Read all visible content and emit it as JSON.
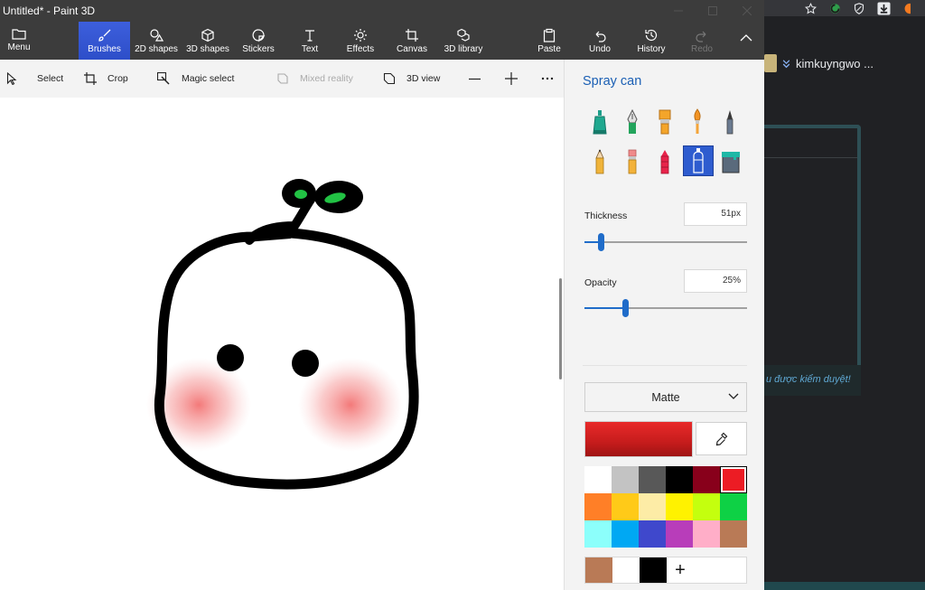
{
  "window": {
    "title": "Untitled* - Paint 3D"
  },
  "ribbon": {
    "menu": "Menu",
    "brushes": "Brushes",
    "shapes2d": "2D shapes",
    "shapes3d": "3D shapes",
    "stickers": "Stickers",
    "text": "Text",
    "effects": "Effects",
    "canvas": "Canvas",
    "library": "3D library",
    "paste": "Paste",
    "undo": "Undo",
    "history": "History",
    "redo": "Redo"
  },
  "toolbar": {
    "select": "Select",
    "crop": "Crop",
    "magic_select": "Magic select",
    "mixed_reality": "Mixed reality",
    "view3d": "3D view"
  },
  "panel": {
    "title": "Spray can",
    "thickness_label": "Thickness",
    "thickness_value": "51px",
    "thickness_fraction": 0.1,
    "opacity_label": "Opacity",
    "opacity_value": "25%",
    "opacity_fraction": 0.25,
    "finish": "Matte",
    "current_color": "#e02424",
    "palette": [
      "#ffffff",
      "#c3c3c3",
      "#585858",
      "#000000",
      "#88001b",
      "#ec1c24",
      "#ff7f27",
      "#ffca18",
      "#fdeca6",
      "#fff200",
      "#c4ff0e",
      "#0ed145",
      "#8cfffb",
      "#00a8f3",
      "#3f48cc",
      "#b83dba",
      "#ffaec8",
      "#b97a56"
    ],
    "selected_swatch": 5,
    "custom_colors": [
      "#b97a56",
      "#ffffff",
      "#000000"
    ]
  },
  "browser": {
    "user_name": "kimkuyngwo ...",
    "moderation_text": "u được kiểm duyệt!"
  }
}
